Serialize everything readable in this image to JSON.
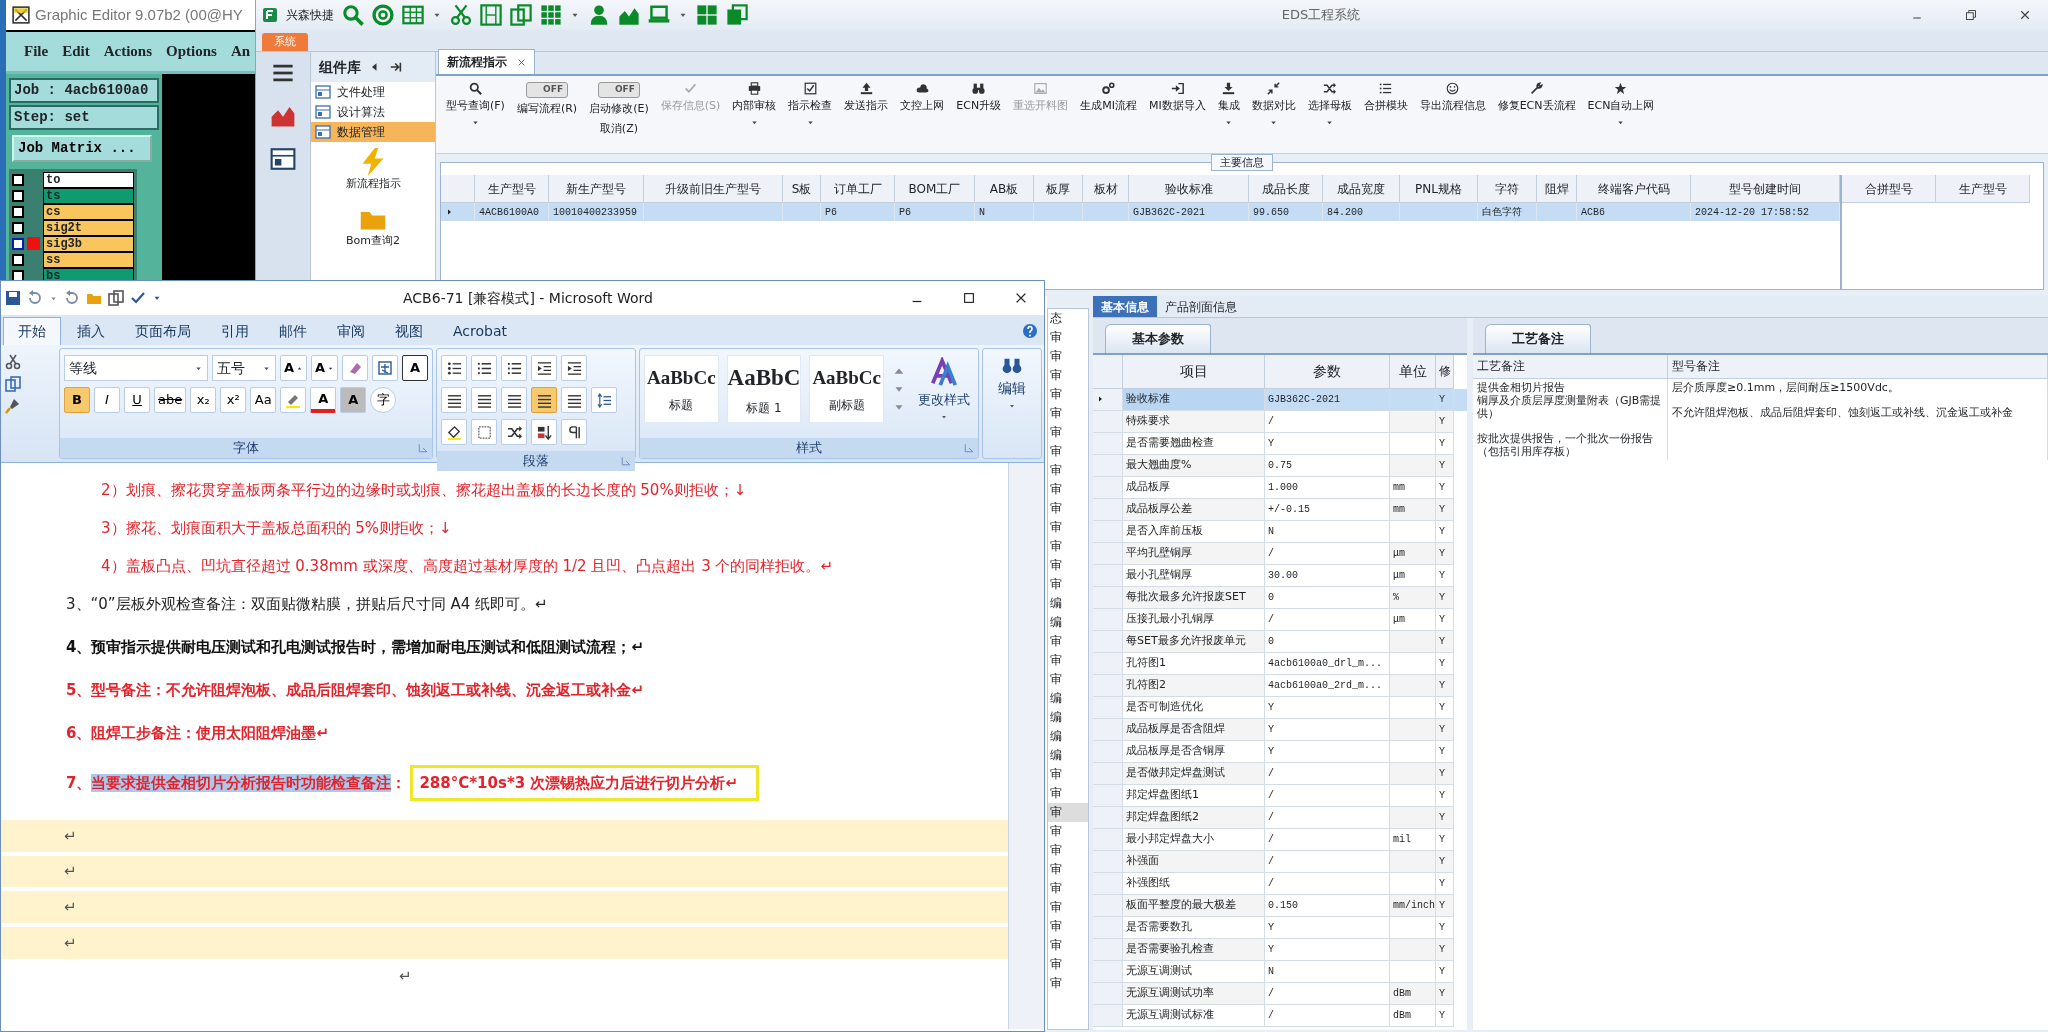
{
  "graphic_editor": {
    "title": "Graphic Editor 9.07b2 (00@HY",
    "menu": [
      "File",
      "Edit",
      "Actions",
      "Options",
      "An"
    ],
    "job": "Job : 4acb6100a0",
    "step": "Step: set",
    "matrix_button": "Job Matrix ...",
    "layers": [
      {
        "name": "to",
        "color": "#ffffff",
        "selected": false
      },
      {
        "name": "ts",
        "color": "#109a70",
        "selected": false
      },
      {
        "name": "cs",
        "color": "#f8c65c",
        "selected": false
      },
      {
        "name": "sig2t",
        "color": "#f8c65c",
        "selected": false
      },
      {
        "name": "sig3b",
        "color": "#f8c65c",
        "selected": true
      },
      {
        "name": "ss",
        "color": "#f8c65c",
        "selected": false
      },
      {
        "name": "bs",
        "color": "#109a70",
        "selected": false
      }
    ]
  },
  "eds": {
    "quick_label": "兴森快捷",
    "title": "EDS工程系统",
    "menu_tab": "系统",
    "nav_title": "组件库",
    "nav_items": [
      {
        "label": "文件处理",
        "selected": false
      },
      {
        "label": "设计算法",
        "selected": false
      },
      {
        "label": "数据管理",
        "selected": true
      }
    ],
    "nav_tools": [
      {
        "label": "新流程指示",
        "kind": "bolt"
      },
      {
        "label": "Bom查询2",
        "kind": "folder"
      }
    ],
    "doc_tab": "新流程指示",
    "toolbar": [
      {
        "kind": "button",
        "label": "型号查询(F)",
        "dropdown": true,
        "disabled": false
      },
      {
        "kind": "toggle",
        "label": "编写流程(R)",
        "switch_text": "OFF",
        "on": false
      },
      {
        "kind": "toggle",
        "label": "启动修改(E)",
        "label2": "取消(Z)",
        "switch_text": "OFF",
        "on": false
      },
      {
        "kind": "button",
        "label": "保存信息(S)",
        "dropdown": false,
        "disabled": true
      },
      {
        "kind": "button",
        "label": "内部审核",
        "dropdown": true,
        "disabled": false
      },
      {
        "kind": "button",
        "label": "指示检查",
        "dropdown": true,
        "disabled": false
      },
      {
        "kind": "button",
        "label": "发送指示",
        "dropdown": false,
        "disabled": false
      },
      {
        "kind": "button",
        "label": "文控上网",
        "dropdown": false,
        "disabled": false
      },
      {
        "kind": "button",
        "label": "ECN升级",
        "dropdown": false,
        "disabled": false
      },
      {
        "kind": "button",
        "label": "重选开料图",
        "dropdown": false,
        "disabled": true
      },
      {
        "kind": "button",
        "label": "生成MI流程",
        "dropdown": false,
        "disabled": false
      },
      {
        "kind": "button",
        "label": "MI数据导入",
        "dropdown": false,
        "disabled": false
      },
      {
        "kind": "button",
        "label": "集成",
        "dropdown": true,
        "disabled": false
      },
      {
        "kind": "button",
        "label": "数据对比",
        "dropdown": true,
        "disabled": false
      },
      {
        "kind": "button",
        "label": "选择母板",
        "dropdown": true,
        "disabled": false
      },
      {
        "kind": "button",
        "label": "合拼模块",
        "dropdown": false,
        "disabled": false
      },
      {
        "kind": "button",
        "label": "导出流程信息",
        "dropdown": false,
        "disabled": false
      },
      {
        "kind": "button",
        "label": "修复ECN丢流程",
        "dropdown": false,
        "disabled": false
      },
      {
        "kind": "button",
        "label": "ECN自动上网",
        "dropdown": true,
        "disabled": false
      }
    ],
    "main_info_title": "主要信息",
    "main_table": {
      "columns": [
        "生产型号",
        "新生产型号",
        "升级前旧生产型号",
        "S板",
        "订单工厂",
        "BOM工厂",
        "AB板",
        "板厚",
        "板材",
        "验收标准",
        "成品长度",
        "成品宽度",
        "PNL规格",
        "字符",
        "阻焊",
        "终端客户代码",
        "型号创建时间"
      ],
      "rows": [
        {
          "selected": true,
          "cells": [
            "4ACB6100A0",
            "10010400233959",
            "",
            "",
            "P6",
            "P6",
            "N",
            "",
            "",
            "GJB362C-2021",
            "99.650",
            "84.200",
            "",
            "白色字符",
            "",
            "ACB6",
            "2024-12-20 17:58:52"
          ]
        }
      ]
    },
    "merge_table": {
      "columns": [
        "合拼型号",
        "生产型号"
      ]
    },
    "side_list_header": "态",
    "side_list": [
      {
        "text": "审",
        "selected": false
      },
      {
        "text": "审",
        "selected": false
      },
      {
        "text": "审",
        "selected": false
      },
      {
        "text": "审",
        "selected": false
      },
      {
        "text": "审",
        "selected": false
      },
      {
        "text": "审",
        "selected": false
      },
      {
        "text": "审",
        "selected": false
      },
      {
        "text": "审",
        "selected": false
      },
      {
        "text": "审",
        "selected": false
      },
      {
        "text": "审",
        "selected": false
      },
      {
        "text": "审",
        "selected": false
      },
      {
        "text": "审",
        "selected": false
      },
      {
        "text": "审",
        "selected": false
      },
      {
        "text": "审",
        "selected": false
      },
      {
        "text": "编",
        "selected": false
      },
      {
        "text": "编",
        "selected": false
      },
      {
        "text": "审",
        "selected": false
      },
      {
        "text": "审",
        "selected": false
      },
      {
        "text": "审",
        "selected": false
      },
      {
        "text": "编",
        "selected": false
      },
      {
        "text": "编",
        "selected": false
      },
      {
        "text": "编",
        "selected": false
      },
      {
        "text": "编",
        "selected": false
      },
      {
        "text": "审",
        "selected": false
      },
      {
        "text": "审",
        "selected": false
      },
      {
        "text": "审",
        "selected": true
      },
      {
        "text": "审",
        "selected": false
      },
      {
        "text": "审",
        "selected": false
      },
      {
        "text": "审",
        "selected": false
      },
      {
        "text": "审",
        "selected": false
      },
      {
        "text": "审",
        "selected": false
      },
      {
        "text": "审",
        "selected": false
      },
      {
        "text": "审",
        "selected": false
      },
      {
        "text": "审",
        "selected": false
      },
      {
        "text": "审",
        "selected": false
      }
    ],
    "detail_tabs": [
      {
        "label": "基本信息",
        "selected": true
      },
      {
        "label": "产品剖面信息",
        "selected": false
      }
    ],
    "param_tab": "基本参数",
    "param_columns": [
      "项目",
      "参数",
      "单位",
      "修"
    ],
    "param_rows": [
      {
        "selected": true,
        "cells": [
          "验收标准",
          "GJB362C-2021",
          "",
          "Y"
        ]
      },
      {
        "selected": false,
        "cells": [
          "特殊要求",
          "/",
          "",
          "Y"
        ]
      },
      {
        "selected": false,
        "cells": [
          "是否需要翘曲检查",
          "Y",
          "",
          "Y"
        ]
      },
      {
        "selected": false,
        "cells": [
          "最大翘曲度%",
          "0.75",
          "",
          "Y"
        ]
      },
      {
        "selected": false,
        "cells": [
          "成品板厚",
          "1.000",
          "mm",
          "Y"
        ]
      },
      {
        "selected": false,
        "cells": [
          "成品板厚公差",
          "+/-0.15",
          "mm",
          "Y"
        ]
      },
      {
        "selected": false,
        "cells": [
          "是否入库前压板",
          "N",
          "",
          "Y"
        ]
      },
      {
        "selected": false,
        "cells": [
          "平均孔壁铜厚",
          "/",
          "μm",
          "Y"
        ]
      },
      {
        "selected": false,
        "cells": [
          "最小孔壁铜厚",
          "30.00",
          "μm",
          "Y"
        ]
      },
      {
        "selected": false,
        "cells": [
          "每批次最多允许报废SET",
          "0",
          "%",
          "Y"
        ]
      },
      {
        "selected": false,
        "cells": [
          "压接孔最小孔铜厚",
          "/",
          "μm",
          "Y"
        ]
      },
      {
        "selected": false,
        "cells": [
          "每SET最多允许报废单元",
          "0",
          "",
          "Y"
        ]
      },
      {
        "selected": false,
        "cells": [
          "孔符图1",
          "4acb6100a0_drl_m...",
          "",
          "Y"
        ]
      },
      {
        "selected": false,
        "cells": [
          "孔符图2",
          "4acb6100a0_2rd_m...",
          "",
          "Y"
        ]
      },
      {
        "selected": false,
        "cells": [
          "是否可制造优化",
          "Y",
          "",
          "Y"
        ]
      },
      {
        "selected": false,
        "cells": [
          "成品板厚是否含阻焊",
          "Y",
          "",
          "Y"
        ]
      },
      {
        "selected": false,
        "cells": [
          "成品板厚是否含铜厚",
          "Y",
          "",
          "Y"
        ]
      },
      {
        "selected": false,
        "cells": [
          "是否做邦定焊盘测试",
          "/",
          "",
          "Y"
        ]
      },
      {
        "selected": false,
        "cells": [
          "邦定焊盘图纸1",
          "/",
          "",
          "Y"
        ]
      },
      {
        "selected": false,
        "cells": [
          "邦定焊盘图纸2",
          "/",
          "",
          "Y"
        ]
      },
      {
        "selected": false,
        "cells": [
          "最小邦定焊盘大小",
          "/",
          "mil",
          "Y"
        ]
      },
      {
        "selected": false,
        "cells": [
          "补强面",
          "/",
          "",
          "Y"
        ]
      },
      {
        "selected": false,
        "cells": [
          "补强图纸",
          "/",
          "",
          "Y"
        ]
      },
      {
        "selected": false,
        "cells": [
          "板面平整度的最大极差",
          "0.150",
          "mm/inch",
          "Y"
        ]
      },
      {
        "selected": false,
        "cells": [
          "是否需要数孔",
          "Y",
          "",
          "Y"
        ]
      },
      {
        "selected": false,
        "cells": [
          "是否需要验孔检查",
          "Y",
          "",
          "Y"
        ]
      },
      {
        "selected": false,
        "cells": [
          "无源互调测试",
          "N",
          "",
          "Y"
        ]
      },
      {
        "selected": false,
        "cells": [
          "无源互调测试功率",
          "/",
          "dBm",
          "Y"
        ]
      },
      {
        "selected": false,
        "cells": [
          "无源互调测试标准",
          "/",
          "dBm",
          "Y"
        ]
      }
    ],
    "remark_tab": "工艺备注",
    "remark_columns": [
      "工艺备注",
      "型号备注"
    ],
    "remark_cells": [
      [
        "提供金相切片报告",
        "铜厚及介质层厚度测量附表（GJB需提供）",
        "",
        "按批次提供报告，一个批次一份报告（包括引用库存板）"
      ],
      [
        "层介质厚度≥0.1mm，层间耐压≥1500Vdc。",
        "",
        "不允许阻焊泡板、成品后阻焊套印、蚀刻返工或补线、沉金返工或补金"
      ]
    ]
  },
  "word": {
    "title": "ACB6-71 [兼容模式] - Microsoft Word",
    "tabs": [
      {
        "label": "开始",
        "selected": true
      },
      {
        "label": "插入",
        "selected": false
      },
      {
        "label": "页面布局",
        "selected": false
      },
      {
        "label": "引用",
        "selected": false
      },
      {
        "label": "邮件",
        "selected": false
      },
      {
        "label": "审阅",
        "selected": false
      },
      {
        "label": "视图",
        "selected": false
      },
      {
        "label": "Acrobat",
        "selected": false
      }
    ],
    "font_name": "等线",
    "font_size": "五号",
    "font_row1": [
      "A",
      "A"
    ],
    "border_letter": "A",
    "font_buttons": [
      {
        "text": "B",
        "selected": true
      },
      {
        "text": "I",
        "selected": false
      },
      {
        "text": "U",
        "selected": false
      },
      {
        "text": "abe",
        "selected": false
      },
      {
        "text": "x₂",
        "selected": false
      },
      {
        "text": "x²",
        "selected": false
      },
      {
        "text": "Aa",
        "selected": false
      }
    ],
    "color_letters": [
      "A",
      "A"
    ],
    "enclose_char": "字",
    "align_buttons": [
      {
        "selected": false
      },
      {
        "selected": false
      },
      {
        "selected": false
      },
      {
        "selected": true
      },
      {
        "selected": false
      }
    ],
    "groups": [
      "字体",
      "段落",
      "样式"
    ],
    "styles": [
      {
        "preview": "AaBbCc",
        "label": "标题"
      },
      {
        "preview": "AaBbC",
        "label": "标题 1"
      },
      {
        "preview": "AaBbCc",
        "label": "副标题"
      }
    ],
    "change_styles": "更改样式",
    "edit": "编辑",
    "paragraphs": [
      {
        "kind": "sub",
        "color": "#e3232b",
        "bold": false,
        "text": "2）划痕、擦花贯穿盖板两条平行边的边缘时或划痕、擦花超出盖板的长边长度的 50%则拒收；↓"
      },
      {
        "kind": "sub",
        "color": "#e3232b",
        "bold": false,
        "text": "3）擦花、划痕面积大于盖板总面积的 5%则拒收；↓"
      },
      {
        "kind": "sub",
        "color": "#e3232b",
        "bold": false,
        "text": "4）盖板凸点、凹坑直径超过 0.38mm 或深度、高度超过基材厚度的 1/2 且凹、凸点超出 3 个的同样拒收。↵"
      },
      {
        "kind": "main",
        "color": "#222222",
        "bold": false,
        "text": "3、“0”层板外观检查备注：双面贴微粘膜，拼贴后尺寸同 A4 纸即可。↵"
      },
      {
        "kind": "main",
        "color": "#111111",
        "bold": true,
        "text": "4、预审指示提供耐电压测试和孔电测试报告时，需增加耐电压测试和低阻测试流程；↵"
      },
      {
        "kind": "main",
        "color": "#e3232b",
        "bold": true,
        "text": "5、型号备注：不允许阻焊泡板、成品后阻焊套印、蚀刻返工或补线、沉金返工或补金↵"
      },
      {
        "kind": "main",
        "color": "#e3232b",
        "bold": true,
        "text": "6、阻焊工步备注：使用太阳阻焊油墨↵"
      },
      {
        "kind": "main",
        "color": "#e3232b",
        "bold": true,
        "runs": [
          {
            "text": "7、",
            "selected": false
          },
          {
            "text": "当要求提供金相切片分析报告时功能检查备注",
            "selected": true
          },
          {
            "text": "：",
            "selected": false
          }
        ],
        "boxed_note": "288°C*10s*3 次漂锡热应力后进行切片分析↵"
      },
      {
        "kind": "mark",
        "color": "#555555",
        "bold": false,
        "text": "↵"
      },
      {
        "kind": "mark",
        "color": "#555555",
        "bold": false,
        "text": "↵"
      },
      {
        "kind": "mark",
        "color": "#555555",
        "bold": false,
        "text": "↵"
      },
      {
        "kind": "mark",
        "color": "#555555",
        "bold": false,
        "text": "↵"
      },
      {
        "kind": "far",
        "color": "#555555",
        "bold": false,
        "text": "↵"
      }
    ]
  }
}
